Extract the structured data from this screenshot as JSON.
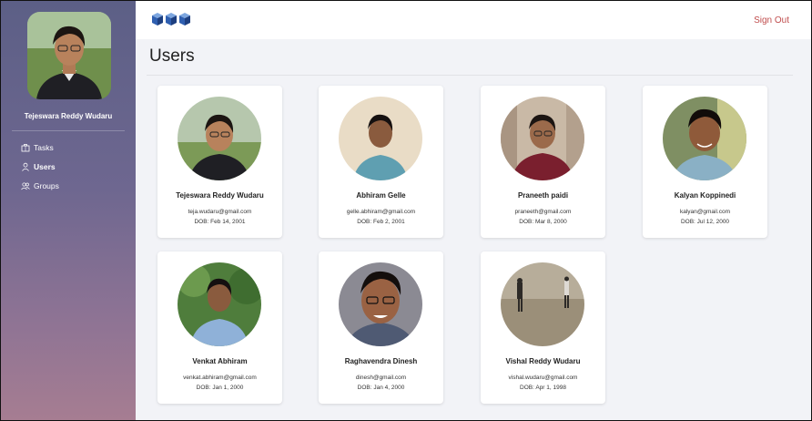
{
  "sidebar": {
    "username": "Tejeswara Reddy Wudaru",
    "items": [
      {
        "label": "Tasks",
        "icon": "briefcase-icon"
      },
      {
        "label": "Users",
        "icon": "user-icon"
      },
      {
        "label": "Groups",
        "icon": "users-icon"
      }
    ]
  },
  "header": {
    "sign_out": "Sign Out"
  },
  "page": {
    "title": "Users"
  },
  "users": [
    {
      "name": "Tejeswara Reddy Wudaru",
      "email": "teja.wudaru@gmail.com",
      "dob": "DOB: Feb 14, 2001"
    },
    {
      "name": "Abhiram Gelle",
      "email": "gelle.abhiram@gmail.com",
      "dob": "DOB: Feb 2, 2001"
    },
    {
      "name": "Praneeth paidi",
      "email": "praneeth@gmail.com",
      "dob": "DOB: Mar 8, 2000"
    },
    {
      "name": "Kalyan Koppinedi",
      "email": "kalyan@gmail.com",
      "dob": "DOB: Jul 12, 2000"
    },
    {
      "name": "Venkat Abhiram",
      "email": "venkat.abhiram@gmail.com",
      "dob": "DOB: Jan 1, 2000"
    },
    {
      "name": "Raghavendra Dinesh",
      "email": "dinesh@gmail.com",
      "dob": "DOB: Jan 4, 2000"
    },
    {
      "name": "Vishal Reddy Wudaru",
      "email": "vishal.wudaru@gmail.com",
      "dob": "DOB: Apr 1, 1998"
    }
  ]
}
